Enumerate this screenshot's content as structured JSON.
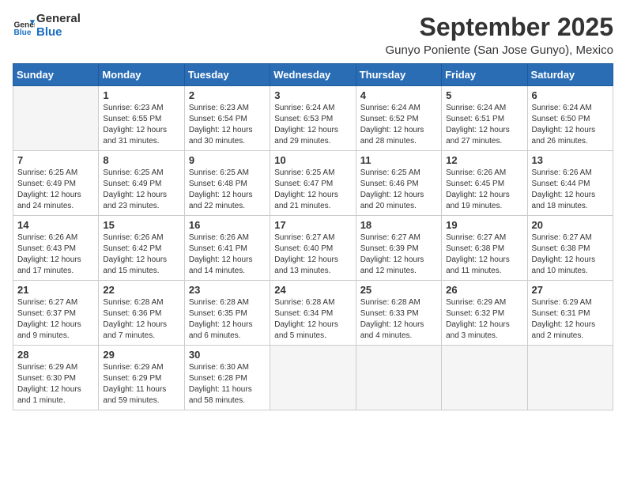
{
  "logo": {
    "general": "General",
    "blue": "Blue"
  },
  "title": "September 2025",
  "location": "Gunyo Poniente (San Jose Gunyo), Mexico",
  "weekdays": [
    "Sunday",
    "Monday",
    "Tuesday",
    "Wednesday",
    "Thursday",
    "Friday",
    "Saturday"
  ],
  "weeks": [
    [
      {
        "day": "",
        "empty": true
      },
      {
        "day": "1",
        "sunrise": "6:23 AM",
        "sunset": "6:55 PM",
        "daylight": "12 hours and 31 minutes."
      },
      {
        "day": "2",
        "sunrise": "6:23 AM",
        "sunset": "6:54 PM",
        "daylight": "12 hours and 30 minutes."
      },
      {
        "day": "3",
        "sunrise": "6:24 AM",
        "sunset": "6:53 PM",
        "daylight": "12 hours and 29 minutes."
      },
      {
        "day": "4",
        "sunrise": "6:24 AM",
        "sunset": "6:52 PM",
        "daylight": "12 hours and 28 minutes."
      },
      {
        "day": "5",
        "sunrise": "6:24 AM",
        "sunset": "6:51 PM",
        "daylight": "12 hours and 27 minutes."
      },
      {
        "day": "6",
        "sunrise": "6:24 AM",
        "sunset": "6:50 PM",
        "daylight": "12 hours and 26 minutes."
      }
    ],
    [
      {
        "day": "7",
        "sunrise": "6:25 AM",
        "sunset": "6:49 PM",
        "daylight": "12 hours and 24 minutes."
      },
      {
        "day": "8",
        "sunrise": "6:25 AM",
        "sunset": "6:49 PM",
        "daylight": "12 hours and 23 minutes."
      },
      {
        "day": "9",
        "sunrise": "6:25 AM",
        "sunset": "6:48 PM",
        "daylight": "12 hours and 22 minutes."
      },
      {
        "day": "10",
        "sunrise": "6:25 AM",
        "sunset": "6:47 PM",
        "daylight": "12 hours and 21 minutes."
      },
      {
        "day": "11",
        "sunrise": "6:25 AM",
        "sunset": "6:46 PM",
        "daylight": "12 hours and 20 minutes."
      },
      {
        "day": "12",
        "sunrise": "6:26 AM",
        "sunset": "6:45 PM",
        "daylight": "12 hours and 19 minutes."
      },
      {
        "day": "13",
        "sunrise": "6:26 AM",
        "sunset": "6:44 PM",
        "daylight": "12 hours and 18 minutes."
      }
    ],
    [
      {
        "day": "14",
        "sunrise": "6:26 AM",
        "sunset": "6:43 PM",
        "daylight": "12 hours and 17 minutes."
      },
      {
        "day": "15",
        "sunrise": "6:26 AM",
        "sunset": "6:42 PM",
        "daylight": "12 hours and 15 minutes."
      },
      {
        "day": "16",
        "sunrise": "6:26 AM",
        "sunset": "6:41 PM",
        "daylight": "12 hours and 14 minutes."
      },
      {
        "day": "17",
        "sunrise": "6:27 AM",
        "sunset": "6:40 PM",
        "daylight": "12 hours and 13 minutes."
      },
      {
        "day": "18",
        "sunrise": "6:27 AM",
        "sunset": "6:39 PM",
        "daylight": "12 hours and 12 minutes."
      },
      {
        "day": "19",
        "sunrise": "6:27 AM",
        "sunset": "6:38 PM",
        "daylight": "12 hours and 11 minutes."
      },
      {
        "day": "20",
        "sunrise": "6:27 AM",
        "sunset": "6:38 PM",
        "daylight": "12 hours and 10 minutes."
      }
    ],
    [
      {
        "day": "21",
        "sunrise": "6:27 AM",
        "sunset": "6:37 PM",
        "daylight": "12 hours and 9 minutes."
      },
      {
        "day": "22",
        "sunrise": "6:28 AM",
        "sunset": "6:36 PM",
        "daylight": "12 hours and 7 minutes."
      },
      {
        "day": "23",
        "sunrise": "6:28 AM",
        "sunset": "6:35 PM",
        "daylight": "12 hours and 6 minutes."
      },
      {
        "day": "24",
        "sunrise": "6:28 AM",
        "sunset": "6:34 PM",
        "daylight": "12 hours and 5 minutes."
      },
      {
        "day": "25",
        "sunrise": "6:28 AM",
        "sunset": "6:33 PM",
        "daylight": "12 hours and 4 minutes."
      },
      {
        "day": "26",
        "sunrise": "6:29 AM",
        "sunset": "6:32 PM",
        "daylight": "12 hours and 3 minutes."
      },
      {
        "day": "27",
        "sunrise": "6:29 AM",
        "sunset": "6:31 PM",
        "daylight": "12 hours and 2 minutes."
      }
    ],
    [
      {
        "day": "28",
        "sunrise": "6:29 AM",
        "sunset": "6:30 PM",
        "daylight": "12 hours and 1 minute."
      },
      {
        "day": "29",
        "sunrise": "6:29 AM",
        "sunset": "6:29 PM",
        "daylight": "11 hours and 59 minutes."
      },
      {
        "day": "30",
        "sunrise": "6:30 AM",
        "sunset": "6:28 PM",
        "daylight": "11 hours and 58 minutes."
      },
      {
        "day": "",
        "empty": true
      },
      {
        "day": "",
        "empty": true
      },
      {
        "day": "",
        "empty": true
      },
      {
        "day": "",
        "empty": true
      }
    ]
  ]
}
